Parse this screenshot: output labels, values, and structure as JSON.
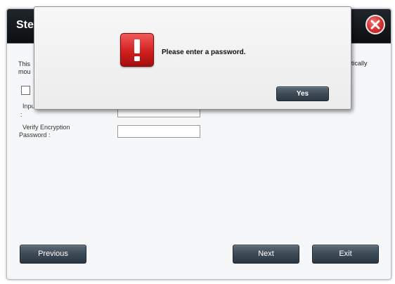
{
  "wizard": {
    "title": "Ste",
    "description_left_line1": "This",
    "description_left_line2": "mou",
    "description_right": "tically",
    "input_label_line1": "Inpu",
    "input_label_line2": ":",
    "input_value": "",
    "verify_label_line1": "Verify Encryption",
    "verify_label_line2": "Password :",
    "verify_value": "",
    "previous_label": "Previous",
    "next_label": "Next",
    "exit_label": "Exit"
  },
  "alert": {
    "message": "Please enter a password.",
    "yes_label": "Yes",
    "icon": "error-exclamation-icon",
    "icon_color": "#d21f1f"
  },
  "colors": {
    "titlebar": "#15191d",
    "button": "#3d4a55",
    "close": "#d83232"
  }
}
